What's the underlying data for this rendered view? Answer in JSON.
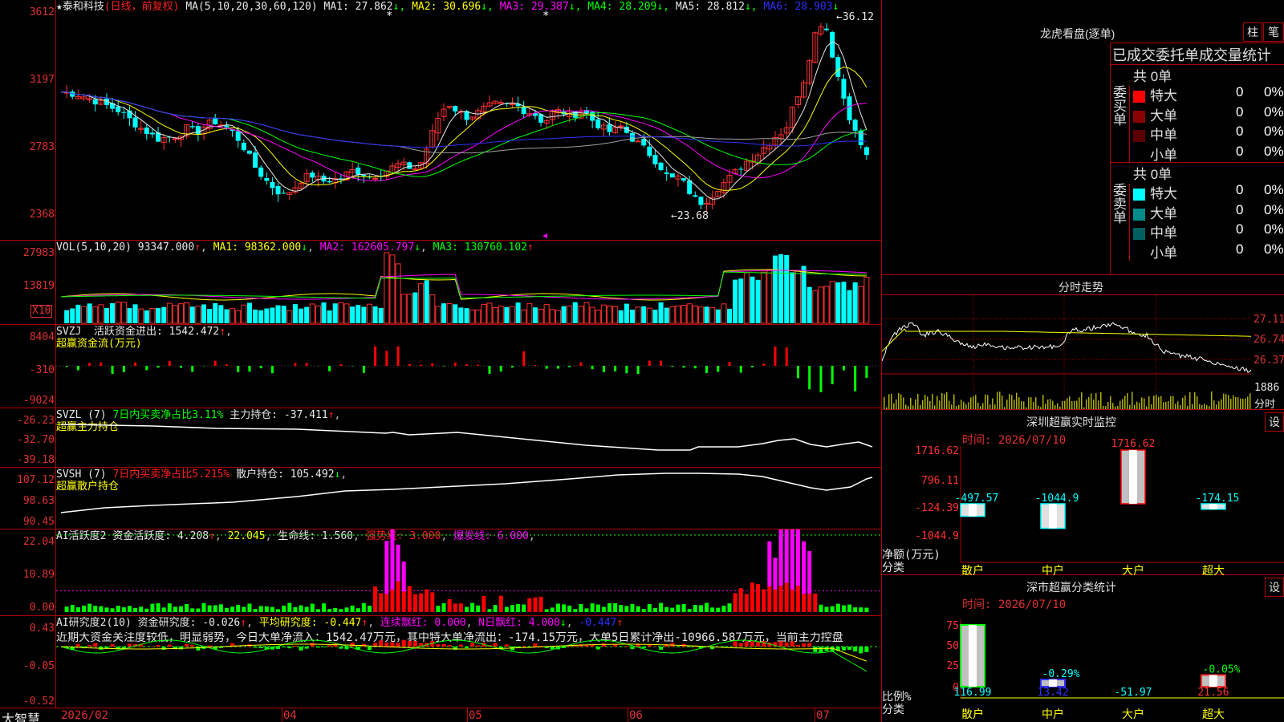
{
  "stock": {
    "name": "泰和科技",
    "mode": "(日线，前复权)"
  },
  "price_panel": {
    "ma_label": "MA(5,10,20,30,60,120)",
    "ma": [
      {
        "label": "MA1: 27.862",
        "arrow": "↓",
        "color": "#e8e8e8"
      },
      {
        "label": "MA2: 30.696",
        "arrow": "↓",
        "color": "#ffff00"
      },
      {
        "label": "MA3: 29.387",
        "arrow": "↓",
        "color": "#ff00ff"
      },
      {
        "label": "MA4: 28.209",
        "arrow": "↓",
        "color": "#00ff00"
      },
      {
        "label": "MA5: 28.812",
        "arrow": "↓",
        "color": "#e8e8e8"
      },
      {
        "label": "MA6: 28.903",
        "arrow": "↓",
        "color": "#3030ff"
      }
    ],
    "yaxis": [
      "3612",
      "3197",
      "2783",
      "2368"
    ],
    "high_label": "36.12",
    "low_label": "23.68"
  },
  "vol_panel": {
    "title": "VOL(5,10,20)",
    "value": "93347.000",
    "ma1": "MA1: 98362.000",
    "ma2": "MA2: 162605.797",
    "ma3": "MA3: 130760.102",
    "yaxis": [
      "27983",
      "13819"
    ],
    "unit": "X10"
  },
  "svzj_panel": {
    "title": "SVZJ",
    "label": "活跃资金进出: 1542.472",
    "sub": "超赢资金流(万元)",
    "yaxis": [
      "8404",
      "-310",
      "-9024"
    ]
  },
  "svzl_panel": {
    "title": "SVZL (7)",
    "label1": "7日内买卖净占比3.11%",
    "label2": "主力持仓: -37.411",
    "sub": "超赢主力持仓",
    "yaxis": [
      "-26.23",
      "-32.70",
      "-39.18"
    ]
  },
  "svsh_panel": {
    "title": "SVSH (7)",
    "label1": "7日内买卖净占比5.215%",
    "label2": "散户持仓: 105.492",
    "sub": "超赢散户持仓",
    "yaxis": [
      "107.12",
      "98.63",
      "90.45"
    ]
  },
  "ai_active_panel": {
    "title": "AI活跃度2",
    "l1": "资金活跃度: 4.208",
    "l2": "22.045",
    "l3": "生命线: 1.560",
    "l4": "强势线: 3.000",
    "l5": "爆发线: 6.000",
    "yaxis": [
      "22.04",
      "10.89",
      "0.00"
    ]
  },
  "ai_research_panel": {
    "title": "AI研究度2(10)",
    "l1": "资金研究度: -0.026",
    "l2": "平均研究度: -0.447",
    "l3": "连续飘红: 0.000",
    "l4": "N日飘红: 4.000",
    "l5": "-0.447",
    "comment": "近期大资金关注度较低，明显弱势，今日大单净流入：1542.47万元，其中特大单净流出：-174.15万元，大单5日累计净出-10966.587万元，当前主力控盘",
    "yaxis": [
      "0.43",
      "-0.05",
      "-0.52"
    ]
  },
  "xaxis": {
    "brand": "大智慧",
    "labels": [
      "2026/02",
      "04",
      "05",
      "06",
      "07"
    ]
  },
  "dragon": {
    "title": "龙虎看盘(逐单)",
    "btn1": "柱",
    "btn2": "笔",
    "tabs": "已成交委托单成交量统计",
    "buy": {
      "side": "委买单",
      "total": "共 0单",
      "rows": [
        {
          "name": "特大",
          "n": "0",
          "p": "0%",
          "color": "#ff0000"
        },
        {
          "name": "大单",
          "n": "0",
          "p": "0%",
          "color": "#8b0000"
        },
        {
          "name": "中单",
          "n": "0",
          "p": "0%",
          "color": "#5a0000"
        },
        {
          "name": "小单",
          "n": "0",
          "p": "0%",
          "color": "#000000"
        }
      ]
    },
    "sell": {
      "side": "委卖单",
      "total": "共 0单",
      "rows": [
        {
          "name": "特大",
          "n": "0",
          "p": "0%",
          "color": "#00ffff"
        },
        {
          "name": "大单",
          "n": "0",
          "p": "0%",
          "color": "#008b8b"
        },
        {
          "name": "中单",
          "n": "0",
          "p": "0%",
          "color": "#006060"
        },
        {
          "name": "小单",
          "n": "0",
          "p": "0%",
          "color": "#000000"
        }
      ]
    }
  },
  "intraday": {
    "title": "分时走势",
    "yaxis": [
      "27.11",
      "26.74",
      "26.37"
    ],
    "vol_label": "1886",
    "vol_unit": "分时"
  },
  "monitor": {
    "title": "深圳超赢实时监控",
    "btn": "设",
    "time": "时间: 2026/07/10",
    "yaxis": [
      "1716.62",
      "796.11",
      "-124.39",
      "-1044.9"
    ],
    "ylabel1": "净额(万元)",
    "ylabel2": "分类",
    "categories": [
      "散户",
      "中户",
      "大户",
      "超大"
    ],
    "values": [
      -497.57,
      -1044.9,
      1716.62,
      -174.15
    ],
    "value_labels": [
      "-497.57",
      "-1044.9",
      "1716.62",
      "-174.15"
    ]
  },
  "classify": {
    "title": "深市超赢分类统计",
    "btn": "设",
    "time": "时间: 2026/07/10",
    "yaxis": [
      "75",
      "50",
      "25",
      "0"
    ],
    "ylabel1": "比例%",
    "ylabel2": "分类",
    "categories": [
      "散户",
      "中户",
      "大户",
      "超大"
    ],
    "bottom_values": [
      "116.99",
      "13.42",
      "-51.97",
      "21.56"
    ],
    "bar_labels": [
      "",
      "-0.29%",
      "",
      "-0.05%"
    ]
  }
}
